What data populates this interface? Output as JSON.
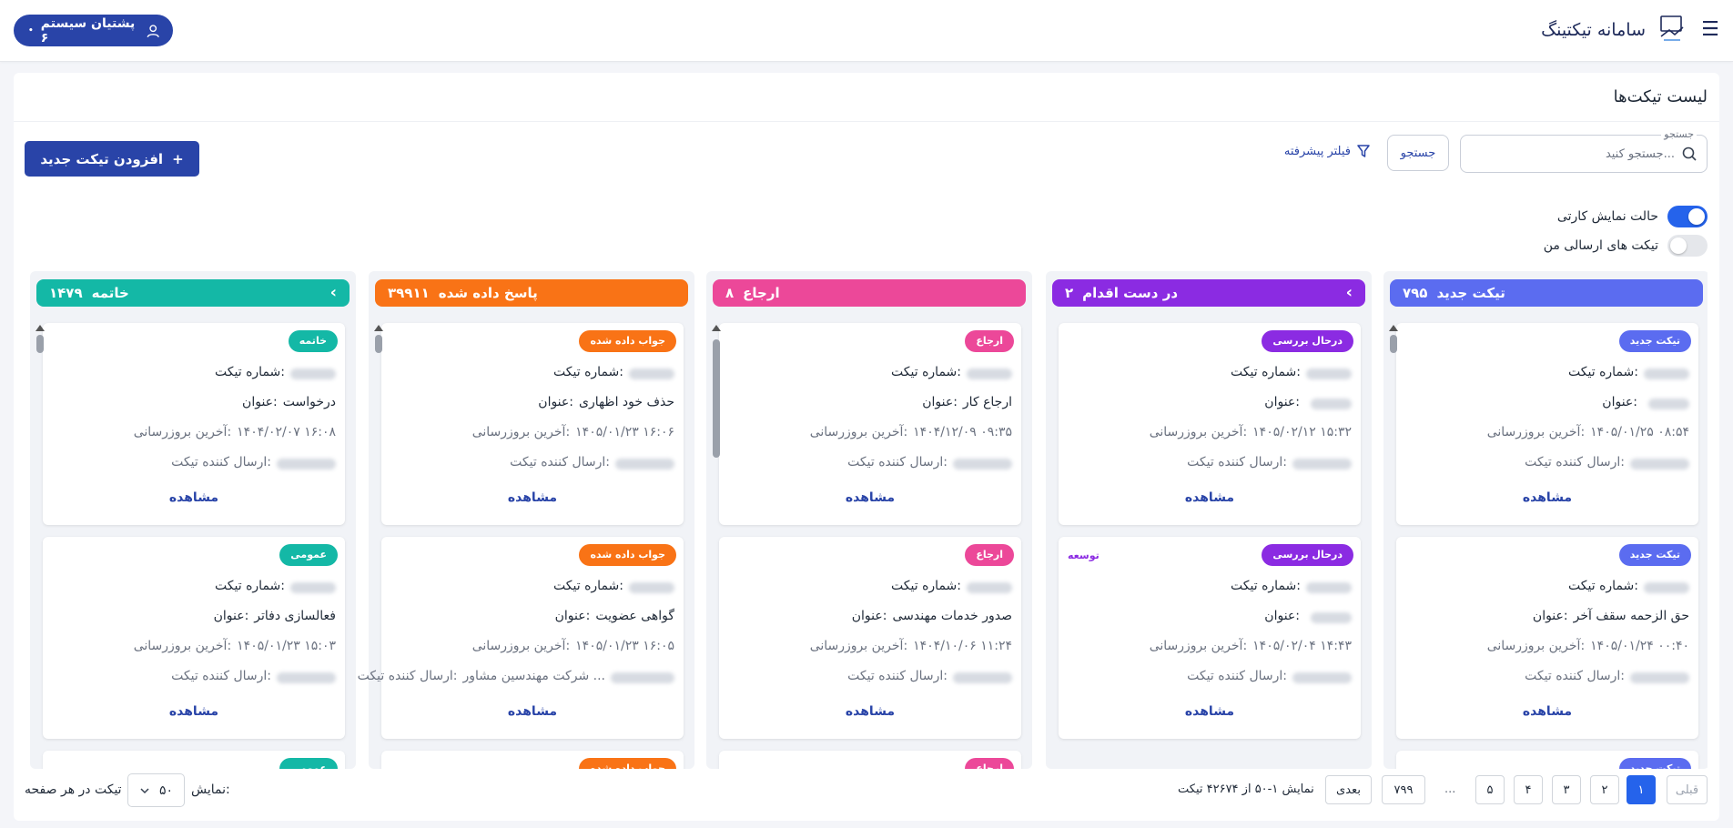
{
  "app": {
    "title": "سامانه تیکتینگ",
    "user_label": "پشتیان سیستم ۶",
    "user_dot": "•"
  },
  "page": {
    "title": "لیست تیکت‌ها"
  },
  "search": {
    "legend": "جستجو",
    "placeholder": "جستجو کنید...",
    "button": "جستجو",
    "advanced_filter": "فیلتر پیشرفته"
  },
  "actions": {
    "add_ticket": "افزودن تیکت جدید",
    "add_icon": "+"
  },
  "toggles": {
    "card_view": {
      "label": "حالت نمایش کارتی",
      "on": true
    },
    "my_tickets": {
      "label": "تیکت های ارسالی من",
      "on": false
    }
  },
  "labels": {
    "ticket_no": "شماره تیکت:",
    "title": "عنوان:",
    "updated": "آخرین بروزرسانی:",
    "sender": "ارسال کننده تیکت:",
    "view": "مشاهده"
  },
  "columns": [
    {
      "name": "تیکت جدید",
      "count": "۷۹۵",
      "color": "#5b6cf0",
      "chevron": "",
      "cards": [
        {
          "badge": "تیکت جدید",
          "badge_color": "#5b6cf0",
          "title": "",
          "updated": "۱۴۰۵/۰۱/۲۵ ۰۸:۵۴",
          "sender": ""
        },
        {
          "badge": "تیکت جدید",
          "badge_color": "#5b6cf0",
          "title": "حق الزحمه سقف آخر",
          "updated": "۱۴۰۵/۰۱/۲۴ ۰۰:۴۰",
          "sender": ""
        }
      ],
      "peek_badge": "تیکت جدید"
    },
    {
      "name": "در دست اقدام",
      "count": "۲",
      "color": "#8b2be2",
      "chevron": "‹",
      "cards": [
        {
          "badge": "درحال بررسی",
          "badge_color": "#8b2be2",
          "title": "",
          "updated": "۱۴۰۵/۰۲/۱۲ ۱۵:۳۲",
          "sender": ""
        },
        {
          "badge": "درحال بررسی",
          "badge_color": "#8b2be2",
          "side_tag": "توسعه",
          "title": "",
          "updated": "۱۴۰۵/۰۲/۰۴ ۱۴:۴۳",
          "sender": ""
        }
      ],
      "peek_badge": ""
    },
    {
      "name": "ارجاع",
      "count": "۸",
      "color": "#ec4899",
      "chevron": "",
      "cards": [
        {
          "badge": "ارجاع",
          "badge_color": "#ec4899",
          "title": "ارجاع کار",
          "updated": "۱۴۰۴/۱۲/۰۹ ۰۹:۳۵",
          "sender": ""
        },
        {
          "badge": "ارجاع",
          "badge_color": "#ec4899",
          "title": "صدور خدمات مهندسی",
          "updated": "۱۴۰۴/۱۰/۰۶ ۱۱:۲۴",
          "sender": ""
        }
      ],
      "peek_badge": "ارجاع"
    },
    {
      "name": "پاسخ داده شده",
      "count": "۳۹۹۱۱",
      "color": "#f97316",
      "chevron": "",
      "cards": [
        {
          "badge": "جواب داده شده",
          "badge_color": "#f97316",
          "title": "حذف خود اظهاری",
          "updated": "۱۴۰۵/۰۱/۲۳ ۱۶:۰۶",
          "sender": ""
        },
        {
          "badge": "جواب داده شده",
          "badge_color": "#f97316",
          "title": "گواهی عضویت",
          "updated": "۱۴۰۵/۰۱/۲۳ ۱۶:۰۵",
          "sender": "شرکت مهندسین مشاور ..."
        }
      ],
      "peek_badge": "جواب داده شده"
    },
    {
      "name": "خاتمه",
      "count": "۱۴۷۹",
      "color": "#14b8a6",
      "chevron": "‹",
      "cards": [
        {
          "badge": "خاتمه",
          "badge_color": "#14b8a6",
          "title": "درخواست",
          "updated": "۱۴۰۴/۰۲/۰۷ ۱۶:۰۸",
          "sender": ""
        },
        {
          "badge": "عمومی",
          "badge_color": "#14b8a6",
          "title": "فعالسازی دفاتر",
          "updated": "۱۴۰۵/۰۱/۲۳ ۱۵:۰۳",
          "sender": ""
        }
      ],
      "peek_badge": "عمومی"
    }
  ],
  "pagination": {
    "prev": "قبلی",
    "next": "بعدی",
    "pages": [
      "۱",
      "۲",
      "۳",
      "۴",
      "۵"
    ],
    "ellipsis": "...",
    "last": "۷۹۹",
    "info": "نمایش ۱-۵۰ از ۴۲۶۷۴ تیکت",
    "show_label": "نمایش:",
    "per_page_value": "۵۰",
    "per_page_suffix": "تیکت در هر صفحه"
  }
}
